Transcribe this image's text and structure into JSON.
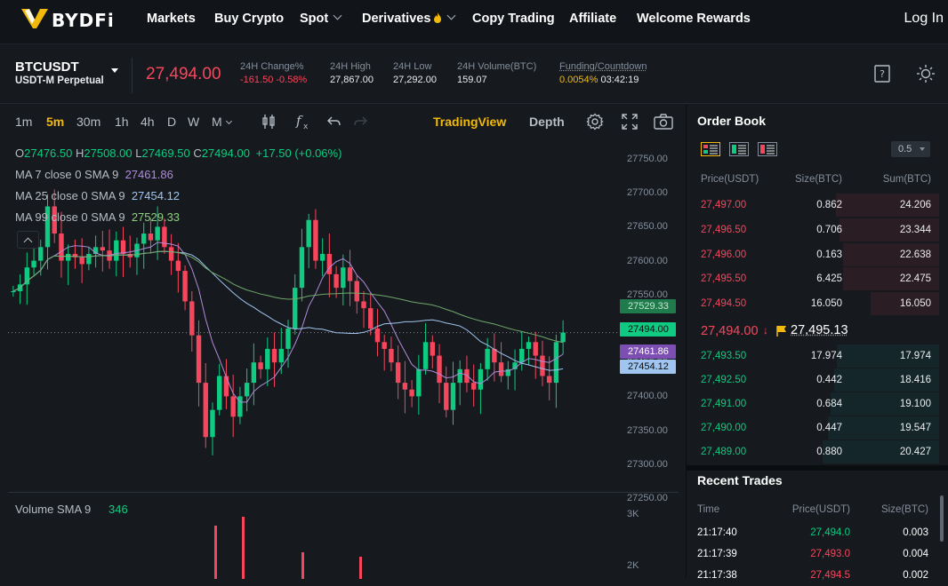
{
  "nav": {
    "logo": "BYDFi",
    "items": [
      "Markets",
      "Buy Crypto",
      "Spot",
      "Derivatives",
      "Copy Trading",
      "Affiliate",
      "Welcome Rewards"
    ],
    "login": "Log In",
    "derivatives_icon": "fire-icon"
  },
  "ticker": {
    "symbol": "BTCUSDT",
    "subtitle": "USDT-M Perpetual",
    "last_price": "27,494.00",
    "change_label": "24H Change%",
    "change_value": "-161.50 -0.58%",
    "high_label": "24H High",
    "high_value": "27,867.00",
    "low_label": "24H Low",
    "low_value": "27,292.00",
    "volume_label": "24H Volume(BTC)",
    "volume_value": "159.07",
    "funding_label": "Funding/Countdown",
    "funding_rate": "0.0054%",
    "countdown": "03:42:19",
    "colors": {
      "down": "#f6465d",
      "up": "#0ecb81",
      "accent": "#f0b90b"
    }
  },
  "toolbar": {
    "intervals": [
      "1m",
      "5m",
      "30m",
      "1h",
      "4h",
      "D",
      "W",
      "M"
    ],
    "active_interval": "5m",
    "tradingview": "TradingView",
    "depth": "Depth"
  },
  "chart": {
    "ohlc": {
      "o_label": "O",
      "o": "27476.50",
      "h_label": "H",
      "h": "27508.00",
      "l_label": "L",
      "l": "27469.50",
      "c_label": "C",
      "c": "27494.00",
      "change": "+17.50 (+0.06%)"
    },
    "ma7": {
      "label": "MA 7 close 0 SMA 9",
      "value": "27461.86"
    },
    "ma25": {
      "label": "MA 25 close 0 SMA 9",
      "value": "27454.12"
    },
    "ma99": {
      "label": "MA 99 close 0 SMA 9",
      "value": "27529.33"
    },
    "y_ticks": [
      "27750.00",
      "27700.00",
      "27650.00",
      "27600.00",
      "27550.00",
      "27500.00",
      "27450.00",
      "27400.00",
      "27350.00",
      "27300.00",
      "27250.00"
    ],
    "tags": {
      "ma99": "27529.33",
      "last": "27494.00",
      "ma7": "27461.86",
      "ma25": "27454.12"
    },
    "volume_label": "Volume SMA 9",
    "volume_value": "346",
    "vol_ticks": [
      "3K",
      "2K"
    ]
  },
  "orderbook": {
    "title": "Order Book",
    "precision": "0.5",
    "headers": [
      "Price(USDT)",
      "Size(BTC)",
      "Sum(BTC)"
    ],
    "asks": [
      {
        "price": "27,497.00",
        "size": "0.862",
        "sum": "24.206"
      },
      {
        "price": "27,496.50",
        "size": "0.706",
        "sum": "23.344"
      },
      {
        "price": "27,496.00",
        "size": "0.163",
        "sum": "22.638"
      },
      {
        "price": "27,495.50",
        "size": "6.425",
        "sum": "22.475"
      },
      {
        "price": "27,494.50",
        "size": "16.050",
        "sum": "16.050"
      }
    ],
    "mid_price": "27,494.00",
    "mid_arrow": "↓",
    "mark_price": "27,495.13",
    "bids": [
      {
        "price": "27,493.50",
        "size": "17.974",
        "sum": "17.974"
      },
      {
        "price": "27,492.50",
        "size": "0.442",
        "sum": "18.416"
      },
      {
        "price": "27,491.00",
        "size": "0.684",
        "sum": "19.100"
      },
      {
        "price": "27,490.00",
        "size": "0.447",
        "sum": "19.547"
      },
      {
        "price": "27,489.00",
        "size": "0.880",
        "sum": "20.427"
      }
    ]
  },
  "trades": {
    "title": "Recent Trades",
    "headers": [
      "Time",
      "Price(USDT)",
      "Size(BTC)"
    ],
    "rows": [
      {
        "time": "21:17:40",
        "price": "27,494.0",
        "size": "0.003",
        "side": "up"
      },
      {
        "time": "21:17:39",
        "price": "27,493.0",
        "size": "0.004",
        "side": "down"
      },
      {
        "time": "21:17:38",
        "price": "27,494.5",
        "size": "0.002",
        "side": "down"
      }
    ]
  }
}
